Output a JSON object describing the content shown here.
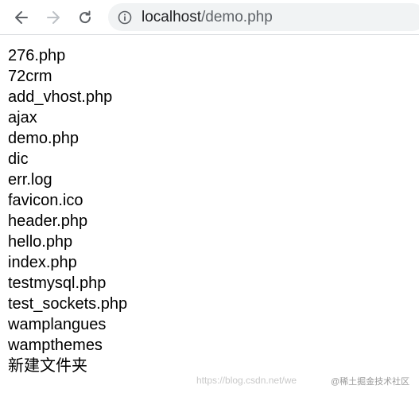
{
  "browser": {
    "address_host": "localhost",
    "address_path": "/demo.php",
    "icons": {
      "back": "back-arrow-icon",
      "forward": "forward-arrow-icon",
      "reload": "reload-icon",
      "site_info": "info-icon"
    }
  },
  "page": {
    "items": [
      "276.php",
      "72crm",
      "add_vhost.php",
      "ajax",
      "demo.php",
      "dic",
      "err.log",
      "favicon.ico",
      "header.php",
      "hello.php",
      "index.php",
      "testmysql.php",
      "test_sockets.php",
      "wamplangues",
      "wampthemes",
      "新建文件夹"
    ]
  },
  "watermark": {
    "url": "https://blog.csdn.net/we",
    "brand": "@稀土掘金技术社区"
  }
}
